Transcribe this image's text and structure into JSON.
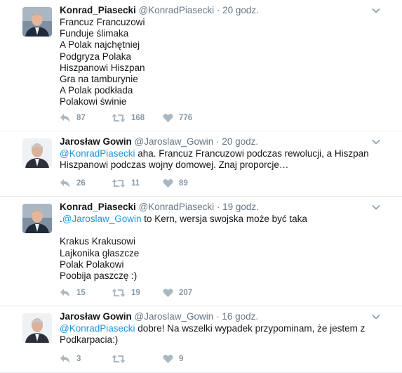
{
  "tweets": [
    {
      "name": "Konrad_Piasecki",
      "handle": "@KonradPiasecki",
      "dot": "·",
      "time": "20 godz.",
      "lines": [
        {
          "text": "Francuz Francuzowi"
        },
        {
          "text": "Funduje ślimaka"
        },
        {
          "text": "A Polak najchętniej"
        },
        {
          "text": "Podgryza Polaka"
        },
        {
          "text": "Hiszpanowi Hiszpan"
        },
        {
          "text": "Gra na tamburynie"
        },
        {
          "text": "A Polak podkłada"
        },
        {
          "text": "Polakowi świnie"
        }
      ],
      "replies": "87",
      "retweets": "168",
      "likes": "776"
    },
    {
      "name": "Jarosław Gowin",
      "handle": "@Jaroslaw_Gowin",
      "dot": "·",
      "time": "20 godz.",
      "lines": [
        {
          "pre": "",
          "mention": "@KonradPiasecki",
          "text": " aha. Francuz Francuzowi podczas rewolucji, a Hiszpan"
        },
        {
          "text": "Hiszpanowi podczas wojny domowej. Znaj proporcje…"
        }
      ],
      "replies": "26",
      "retweets": "11",
      "likes": "89"
    },
    {
      "name": "Konrad_Piasecki",
      "handle": "@KonradPiasecki",
      "dot": "·",
      "time": "19 godz.",
      "lines": [
        {
          "pre": ".",
          "mention": "@Jaroslaw_Gowin",
          "text": " to Kern, wersja swojska może być taka"
        },
        {
          "text": ""
        },
        {
          "text": "Krakus Krakusowi"
        },
        {
          "text": "Lajkonika głaszcze"
        },
        {
          "text": "Polak Polakowi"
        },
        {
          "text": "Poobija paszczę :)"
        }
      ],
      "replies": "15",
      "retweets": "19",
      "likes": "207"
    },
    {
      "name": "Jarosław Gowin",
      "handle": "@Jaroslaw_Gowin",
      "dot": "·",
      "time": "16 godz.",
      "lines": [
        {
          "pre": "",
          "mention": "@KonradPiasecki",
          "text": " dobre! Na wszelki wypadek przypominam, że jestem z"
        },
        {
          "text": "Podkarpacia:)"
        }
      ],
      "replies": "3",
      "retweets": "",
      "likes": "9"
    }
  ],
  "icons": {
    "reply": "reply-icon",
    "retweet": "retweet-icon",
    "like": "heart-icon",
    "menu": "chevron-down-icon"
  },
  "colors": {
    "mention": "#1b95e0",
    "secondary": "#657786",
    "action": "#8899a6",
    "divider": "#e6ecf0"
  }
}
